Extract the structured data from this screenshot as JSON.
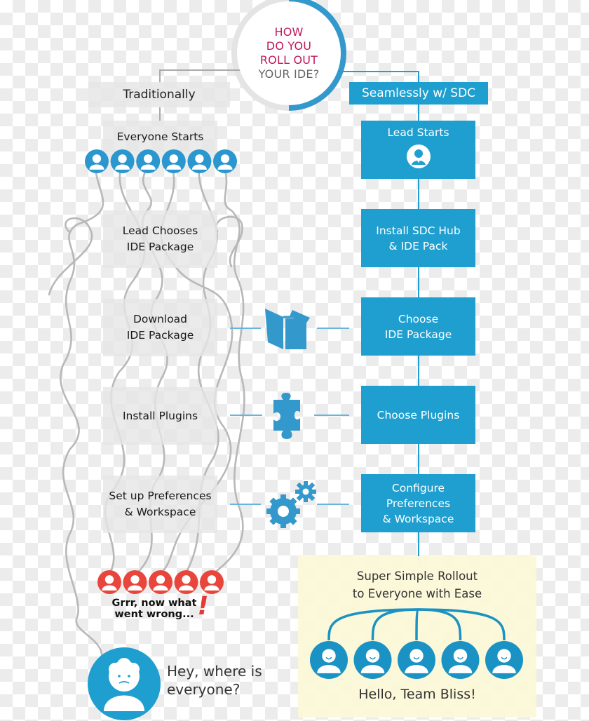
{
  "hub": {
    "line1": "HOW",
    "line2": "DO YOU",
    "line3": "ROLL OUT",
    "line4": "YOUR IDE?"
  },
  "colors": {
    "accent_blue": "#1e9fd0",
    "icon_blue": "#3399cc",
    "question_pink": "#c2185b",
    "alert_red": "#e53935",
    "bliss_bg": "#fcf9d7",
    "tangle_grey": "#b5b5b5"
  },
  "traditional": {
    "header": "Traditionally",
    "steps": [
      {
        "label": "Everyone Starts"
      },
      {
        "label": "Lead Chooses\nIDE Package"
      },
      {
        "label": "Download\nIDE Package"
      },
      {
        "label": "Install Plugins"
      },
      {
        "label": "Set up Preferences\n& Workspace"
      }
    ],
    "start_users_icon": "user-icon",
    "start_user_count": 6,
    "frustrated_users_icon": "angry-user-icon",
    "frustrated_user_count": 5,
    "frustrated_caption": "Grrr, now what\nwent wrong...",
    "exclamation": "!",
    "lonely_caption": "Hey, where is\neveryone?",
    "lonely_icon": "sad-user-icon"
  },
  "sdc": {
    "header": "Seamlessly w/ SDC",
    "steps": [
      {
        "label": "Lead Starts",
        "icon": "lead-user-icon"
      },
      {
        "label": "Install SDC Hub\n& IDE Pack"
      },
      {
        "label": "Choose\nIDE Package"
      },
      {
        "label": "Choose Plugins"
      },
      {
        "label": "Configure\nPreferences\n& Workspace"
      }
    ],
    "result_title": "Super Simple Rollout\nto Everyone with Ease",
    "result_user_count": 5,
    "result_icon": "happy-user-icon",
    "result_caption": "Hello, Team Bliss!"
  },
  "connectors": [
    {
      "icon": "open-box-icon",
      "meaning": "package"
    },
    {
      "icon": "puzzle-piece-icon",
      "meaning": "plugins"
    },
    {
      "icon": "gears-icon",
      "meaning": "preferences"
    }
  ]
}
